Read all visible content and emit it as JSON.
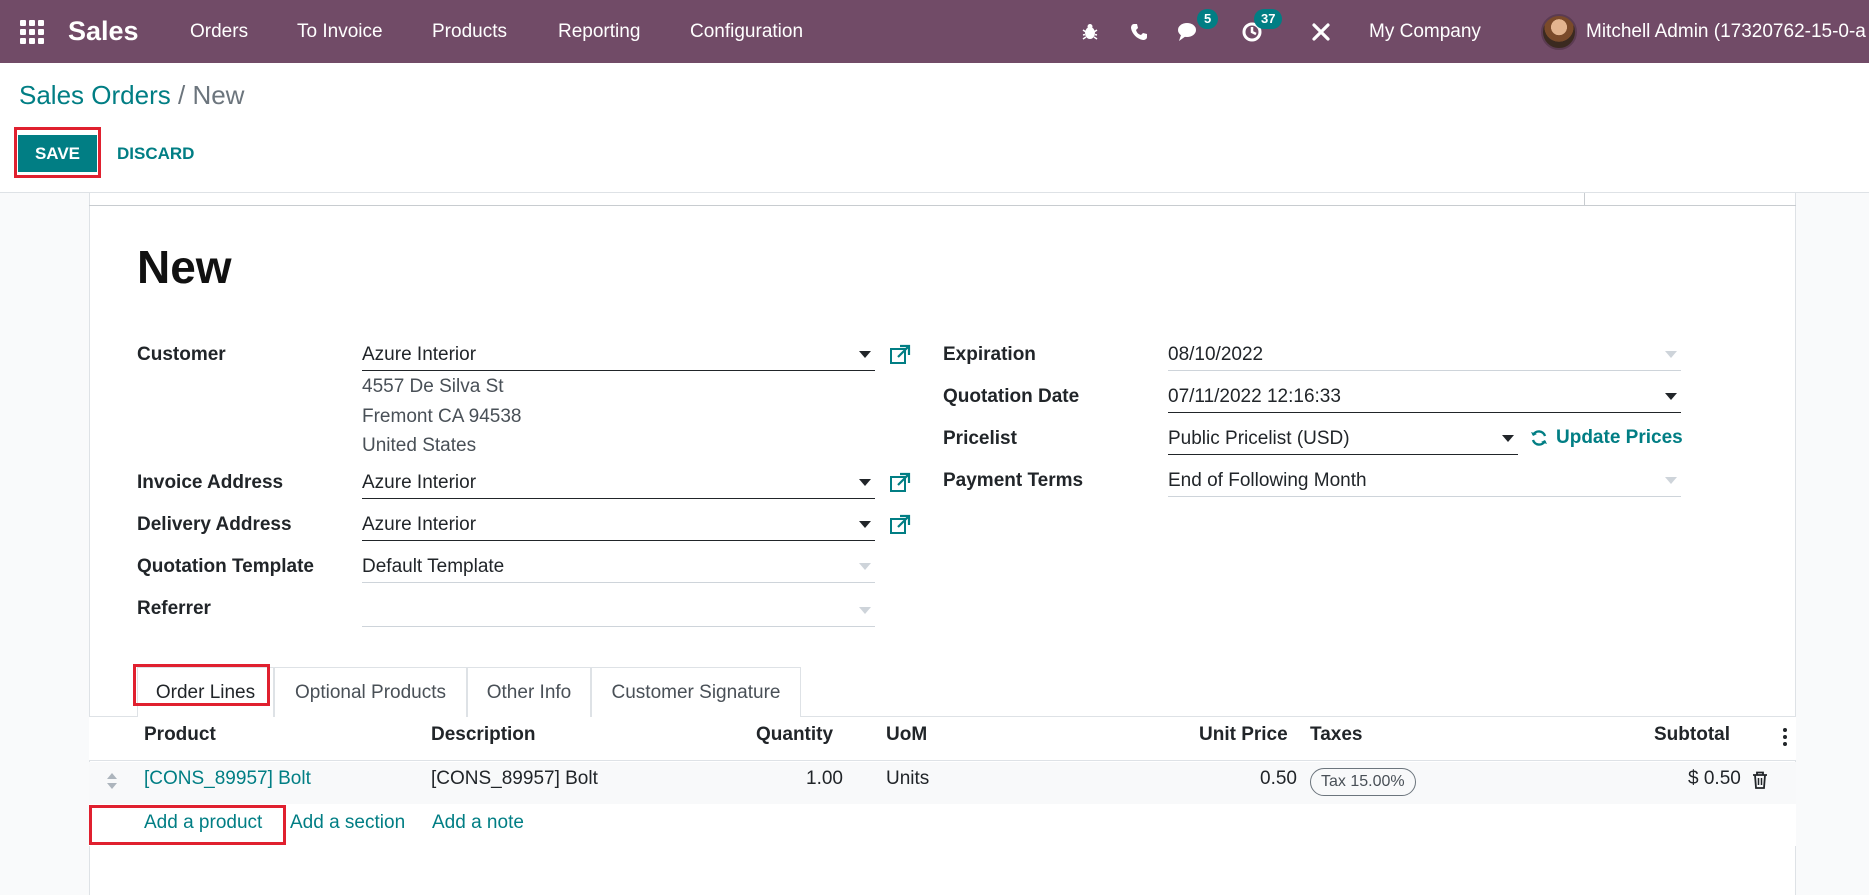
{
  "navbar": {
    "app_name": "Sales",
    "menu": [
      "Orders",
      "To Invoice",
      "Products",
      "Reporting",
      "Configuration"
    ],
    "messages_count": "5",
    "activities_count": "37",
    "company": "My Company",
    "user": "Mitchell Admin (17320762-15-0-a"
  },
  "breadcrumb": {
    "parent": "Sales Orders",
    "separator": "/",
    "current": "New"
  },
  "actions": {
    "save": "SAVE",
    "discard": "DISCARD"
  },
  "form": {
    "title": "New",
    "customer_label": "Customer",
    "customer_value": "Azure Interior",
    "customer_address": [
      "4557 De Silva St",
      "Fremont CA 94538",
      "United States"
    ],
    "invoice_address_label": "Invoice Address",
    "invoice_address_value": "Azure Interior",
    "delivery_address_label": "Delivery Address",
    "delivery_address_value": "Azure Interior",
    "quotation_template_label": "Quotation Template",
    "quotation_template_value": "Default Template",
    "referrer_label": "Referrer",
    "referrer_value": "",
    "expiration_label": "Expiration",
    "expiration_value": "08/10/2022",
    "quotation_date_label": "Quotation Date",
    "quotation_date_value": "07/11/2022 12:16:33",
    "pricelist_label": "Pricelist",
    "pricelist_value": "Public Pricelist (USD)",
    "update_prices": "Update Prices",
    "payment_terms_label": "Payment Terms",
    "payment_terms_value": "End of Following Month"
  },
  "tabs": [
    "Order Lines",
    "Optional Products",
    "Other Info",
    "Customer Signature"
  ],
  "order_lines": {
    "columns": [
      "Product",
      "Description",
      "Quantity",
      "UoM",
      "Unit Price",
      "Taxes",
      "Subtotal"
    ],
    "rows": [
      {
        "product": "[CONS_89957] Bolt",
        "description": "[CONS_89957] Bolt",
        "quantity": "1.00",
        "uom": "Units",
        "unit_price": "0.50",
        "taxes": "Tax 15.00%",
        "subtotal": "$ 0.50"
      }
    ],
    "add_product": "Add a product",
    "add_section": "Add a section",
    "add_note": "Add a note"
  },
  "colors": {
    "navbar": "#714B67",
    "accent": "#017E84",
    "highlight": "#e0202f"
  }
}
